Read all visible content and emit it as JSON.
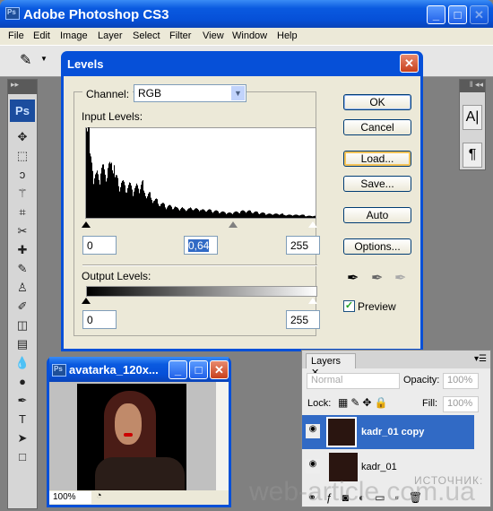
{
  "app": {
    "title": "Adobe Photoshop CS3",
    "icon": "ps-icon"
  },
  "menu": [
    "File",
    "Edit",
    "Image",
    "Layer",
    "Select",
    "Filter",
    "View",
    "Window",
    "Help"
  ],
  "toolbox": {
    "logo": "Ps",
    "tools": [
      "move-icon",
      "marquee-icon",
      "lasso-icon",
      "magic-wand-icon",
      "crop-icon",
      "slice-icon",
      "healing-icon",
      "brush-icon",
      "stamp-icon",
      "history-brush-icon",
      "eraser-icon",
      "gradient-icon",
      "blur-icon",
      "dodge-icon",
      "pen-icon",
      "type-icon",
      "path-select-icon",
      "shape-icon"
    ]
  },
  "levels": {
    "title": "Levels",
    "channel_label": "Channel:",
    "channel_value": "RGB",
    "input_label": "Input Levels:",
    "input_black": "0",
    "input_gamma": "0,64",
    "input_white": "255",
    "output_label": "Output Levels:",
    "output_black": "0",
    "output_white": "255",
    "buttons": {
      "ok": "OK",
      "cancel": "Cancel",
      "load": "Load...",
      "save": "Save...",
      "auto": "Auto",
      "options": "Options..."
    },
    "preview_label": "Preview",
    "preview_checked": true
  },
  "chart_data": {
    "type": "bar",
    "title": "",
    "xlim": [
      0,
      255
    ],
    "bins": 64,
    "values": [
      100,
      60,
      42,
      45,
      50,
      48,
      52,
      58,
      40,
      36,
      35,
      32,
      33,
      30,
      32,
      35,
      26,
      24,
      20,
      18,
      15,
      14,
      12,
      12,
      11,
      10,
      10,
      9,
      9,
      10,
      9,
      9,
      8,
      8,
      8,
      7,
      7,
      6,
      6,
      5,
      5,
      6,
      6,
      7,
      7,
      7,
      6,
      6,
      5,
      5,
      4,
      4,
      4,
      4,
      4,
      3,
      3,
      3,
      3,
      3,
      3,
      2,
      2,
      2
    ]
  },
  "document": {
    "title": "avatarka_120x...",
    "zoom": "100%"
  },
  "layers": {
    "tab": "Layers",
    "blend_mode": "Normal",
    "opacity_label": "Opacity:",
    "opacity": "100%",
    "lock_label": "Lock:",
    "fill_label": "Fill:",
    "fill": "100%",
    "items": [
      {
        "name": "kadr_01 copy",
        "selected": true
      },
      {
        "name": "kadr_01",
        "selected": false
      }
    ]
  },
  "watermark": {
    "source": "ИСТОЧНИК:",
    "site": "web-article.com.ua"
  }
}
